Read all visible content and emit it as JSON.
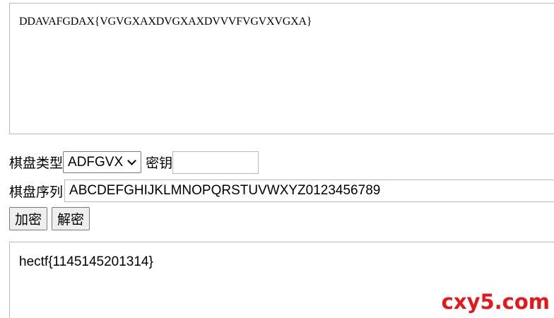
{
  "ciphertext": {
    "value": "DDAVAFGDAX{VGVGXAXDVGXAXDVVVFVGVXVGXA}"
  },
  "board_type": {
    "label": "棋盘类型",
    "selected": "ADFGVX"
  },
  "key": {
    "label": "密钥",
    "value": ""
  },
  "board_sequence": {
    "label": "棋盘序列",
    "value": "ABCDEFGHIJKLMNOPQRSTUVWXYZ0123456789"
  },
  "buttons": {
    "encrypt": "加密",
    "decrypt": "解密"
  },
  "result": {
    "value": "hectf{1145145201314}"
  },
  "watermark": {
    "text": "cxy5.com",
    "color": "#e8151b"
  }
}
